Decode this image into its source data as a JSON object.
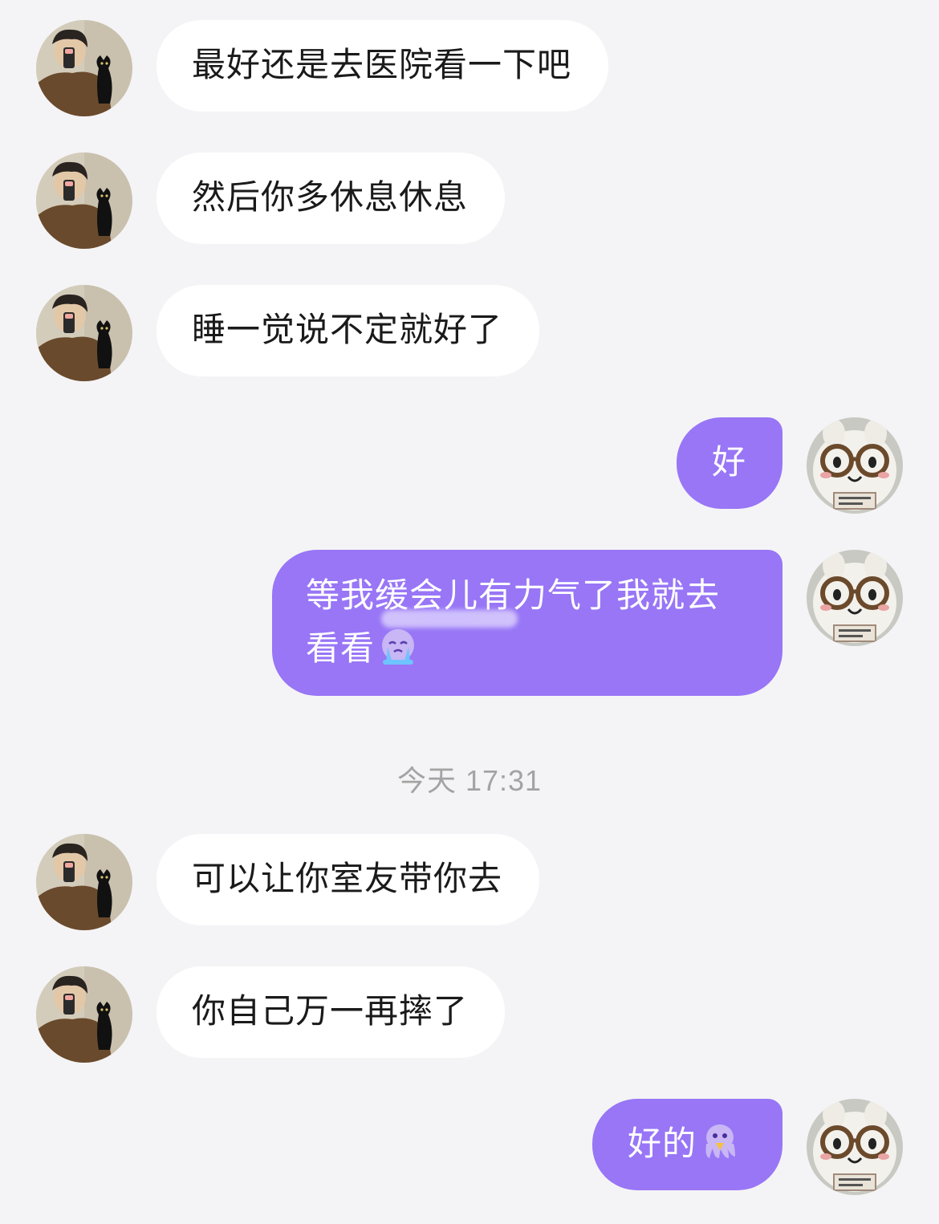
{
  "chat": {
    "messages": [
      {
        "side": "in",
        "text": "最好还是去医院看一下吧"
      },
      {
        "side": "in",
        "text": "然后你多休息休息"
      },
      {
        "side": "in",
        "text": "睡一觉说不定就好了"
      },
      {
        "side": "out",
        "text": "好"
      },
      {
        "side": "out",
        "text": "等我缓会儿有力气了我就去看看",
        "emoji": "crying-face-emoji"
      },
      {
        "side": "in",
        "text": "可以让你室友带你去"
      },
      {
        "side": "in",
        "text": "你自己万一再摔了"
      },
      {
        "side": "out",
        "text": "好的",
        "emoji": "pleading-octopus-emoji"
      }
    ],
    "timestamp": "今天 17:31"
  },
  "colors": {
    "background": "#f4f4f6",
    "incoming_bubble": "#ffffff",
    "outgoing_bubble": "#9876f6",
    "timestamp_text": "#a3a3a3"
  },
  "icons": {
    "contact_avatar": "contact-avatar-icon",
    "my_avatar": "my-avatar-icon"
  }
}
